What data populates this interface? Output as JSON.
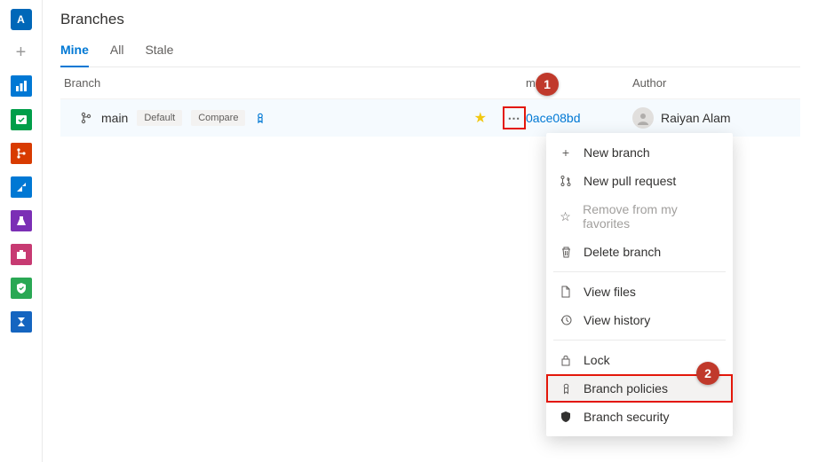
{
  "leftnav": {
    "project_initial": "A",
    "project_bg": "#0067b8"
  },
  "page": {
    "title": "Branches"
  },
  "tabs": [
    {
      "label": "Mine",
      "active": true
    },
    {
      "label": "All",
      "active": false
    },
    {
      "label": "Stale",
      "active": false
    }
  ],
  "columns": {
    "branch": "Branch",
    "commit": "mmit",
    "author": "Author"
  },
  "branch": {
    "name": "main",
    "default_tag": "Default",
    "compare_tag": "Compare",
    "commit": "0ace08bd",
    "author": "Raiyan Alam"
  },
  "menu": {
    "new_branch": "New branch",
    "new_pr": "New pull request",
    "remove_fav": "Remove from my favorites",
    "delete": "Delete branch",
    "view_files": "View files",
    "view_history": "View history",
    "lock": "Lock",
    "policies": "Branch policies",
    "security": "Branch security"
  },
  "callouts": {
    "one": "1",
    "two": "2"
  }
}
